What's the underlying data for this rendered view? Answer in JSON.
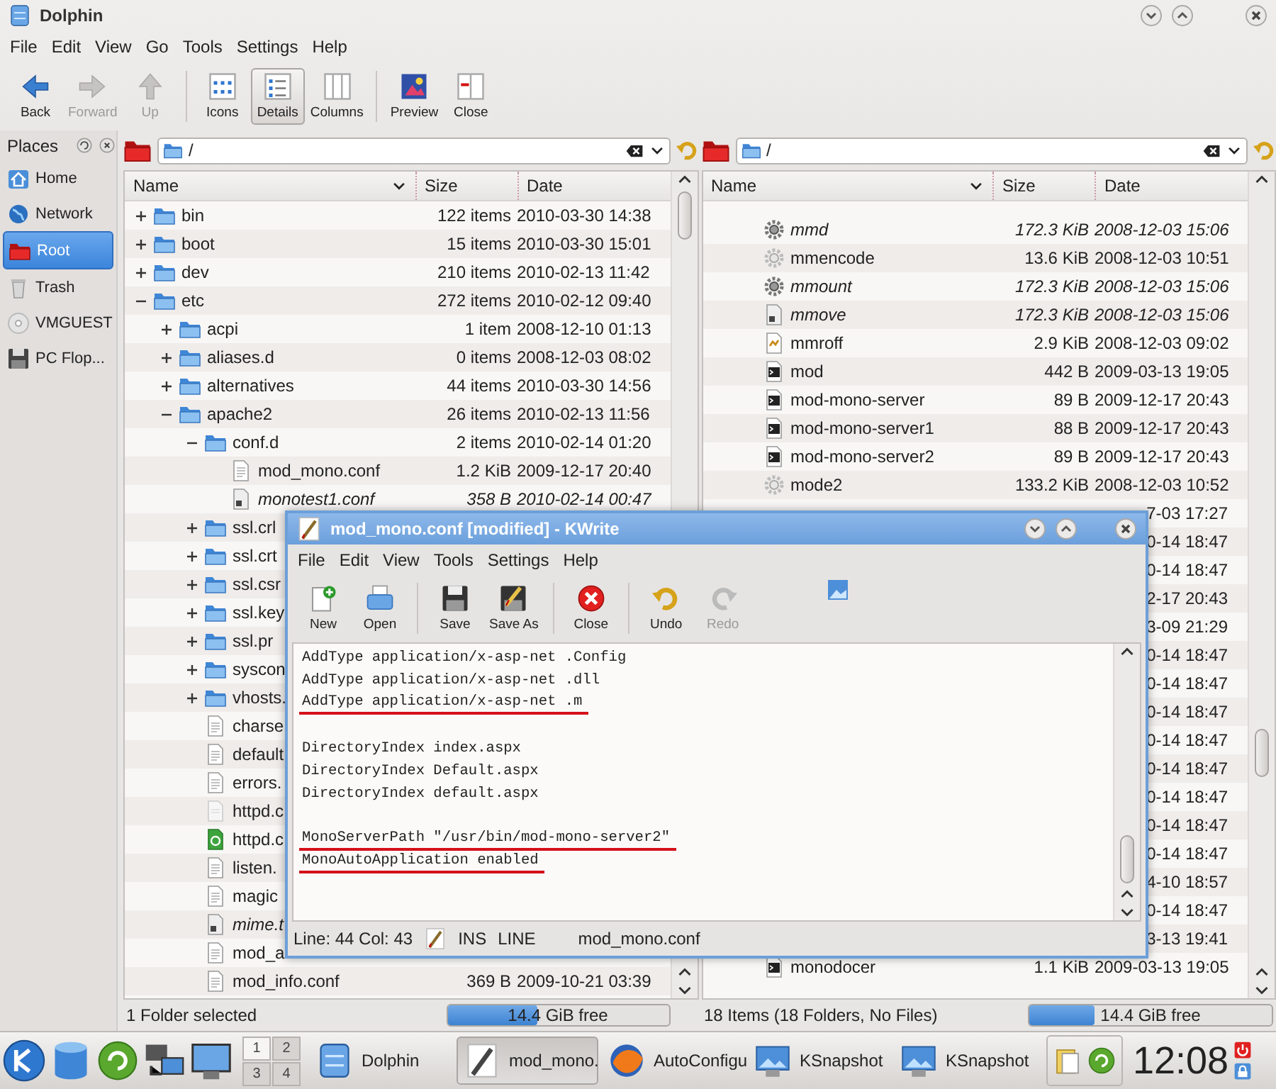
{
  "window": {
    "title": "Dolphin"
  },
  "menu": [
    "File",
    "Edit",
    "View",
    "Go",
    "Tools",
    "Settings",
    "Help"
  ],
  "nav": [
    {
      "label": "Back",
      "kind": "back",
      "disabled": false
    },
    {
      "label": "Forward",
      "kind": "forward",
      "disabled": true
    },
    {
      "label": "Up",
      "kind": "up",
      "disabled": true
    }
  ],
  "views": [
    {
      "label": "Icons",
      "kind": "icons",
      "selected": false
    },
    {
      "label": "Details",
      "kind": "details",
      "selected": true
    },
    {
      "label": "Columns",
      "kind": "columns",
      "selected": false
    }
  ],
  "actions": [
    {
      "label": "Preview",
      "kind": "preview"
    },
    {
      "label": "Close",
      "kind": "close"
    }
  ],
  "places": {
    "title": "Places",
    "items": [
      {
        "label": "Home",
        "kind": "home",
        "selected": false
      },
      {
        "label": "Network",
        "kind": "network",
        "selected": false
      },
      {
        "label": "Root",
        "kind": "root",
        "selected": true
      },
      {
        "label": "Trash",
        "kind": "trash",
        "selected": false
      },
      {
        "label": "VMGUEST",
        "kind": "disc",
        "selected": false
      },
      {
        "label": "PC Flop...",
        "kind": "floppy",
        "selected": false
      }
    ]
  },
  "panes": [
    {
      "kind": "tree",
      "location": "/",
      "columns": [
        "Name",
        "Size",
        "Date"
      ],
      "rows": [
        {
          "name": "bin",
          "size": "122 items",
          "date": "2010-03-30 14:38",
          "kind": "folder",
          "expanded": false
        },
        {
          "name": "boot",
          "size": "15 items",
          "date": "2010-03-30 15:01",
          "kind": "folder",
          "expanded": false
        },
        {
          "name": "dev",
          "size": "210 items",
          "date": "2010-02-13 11:42",
          "kind": "folder",
          "expanded": false
        },
        {
          "name": "etc",
          "size": "272 items",
          "date": "2010-02-12 09:40",
          "kind": "folder",
          "expanded": true,
          "children": [
            {
              "name": "acpi",
              "size": "1 item",
              "date": "2008-12-10 01:13",
              "kind": "folder",
              "expanded": false
            },
            {
              "name": "aliases.d",
              "size": "0 items",
              "date": "2008-12-03 08:02",
              "kind": "folder",
              "expanded": false
            },
            {
              "name": "alternatives",
              "size": "44 items",
              "date": "2010-03-30 14:56",
              "kind": "folder",
              "expanded": false
            },
            {
              "name": "apache2",
              "size": "26 items",
              "date": "2010-02-13 11:56",
              "kind": "folder",
              "expanded": true,
              "children": [
                {
                  "name": "conf.d",
                  "size": "2 items",
                  "date": "2010-02-14 01:20",
                  "kind": "folder",
                  "expanded": true,
                  "children": [
                    {
                      "name": "mod_mono.conf",
                      "size": "1.2 KiB",
                      "date": "2009-12-17 20:40",
                      "kind": "text"
                    },
                    {
                      "name": "monotest1.conf",
                      "size": "358 B",
                      "date": "2010-02-14 00:47",
                      "kind": "link"
                    }
                  ]
                },
                {
                  "name": "ssl.crl",
                  "kind": "folder",
                  "expanded": false
                },
                {
                  "name": "ssl.crt",
                  "kind": "folder",
                  "expanded": false
                },
                {
                  "name": "ssl.csr",
                  "kind": "folder",
                  "expanded": false
                },
                {
                  "name": "ssl.key",
                  "kind": "folder",
                  "expanded": false
                },
                {
                  "name": "ssl.pr",
                  "kind": "folder",
                  "expanded": false
                },
                {
                  "name": "syscon",
                  "kind": "folder",
                  "expanded": false
                },
                {
                  "name": "vhosts.",
                  "kind": "folder",
                  "expanded": false
                },
                {
                  "name": "charse",
                  "kind": "text"
                },
                {
                  "name": "default",
                  "kind": "text"
                },
                {
                  "name": "errors.",
                  "kind": "text"
                },
                {
                  "name": "httpd.c",
                  "kind": "html"
                },
                {
                  "name": "httpd.c",
                  "kind": "package"
                },
                {
                  "name": "listen.",
                  "kind": "text"
                },
                {
                  "name": "magic",
                  "kind": "text"
                },
                {
                  "name": "mime.t",
                  "kind": "link"
                },
                {
                  "name": "mod_a",
                  "kind": "text"
                },
                {
                  "name": "mod_info.conf",
                  "size": "369 B",
                  "date": "2009-10-21 03:39",
                  "kind": "text"
                }
              ]
            }
          ]
        }
      ],
      "status": "1 Folder selected",
      "free": {
        "label": "14.4 GiB free",
        "level": 0.41
      }
    },
    {
      "kind": "flat",
      "location": "/",
      "columns": [
        "Name",
        "Size",
        "Date"
      ],
      "rows": [
        {
          "name": "mmd",
          "size": "172.3 KiB",
          "date": "2008-12-03 15:06",
          "kind": "link-gear"
        },
        {
          "name": "mmencode",
          "size": "13.6 KiB",
          "date": "2008-12-03 10:51",
          "kind": "gear"
        },
        {
          "name": "mmount",
          "size": "172.3 KiB",
          "date": "2008-12-03 15:06",
          "kind": "link-gear"
        },
        {
          "name": "mmove",
          "size": "172.3 KiB",
          "date": "2008-12-03 15:06",
          "kind": "link"
        },
        {
          "name": "mmroff",
          "size": "2.9 KiB",
          "date": "2008-12-03 09:02",
          "kind": "script"
        },
        {
          "name": "mod",
          "size": "442 B",
          "date": "2009-03-13 19:05",
          "kind": "terminal"
        },
        {
          "name": "mod-mono-server",
          "size": "89 B",
          "date": "2009-12-17 20:43",
          "kind": "terminal"
        },
        {
          "name": "mod-mono-server1",
          "size": "88 B",
          "date": "2009-12-17 20:43",
          "kind": "terminal"
        },
        {
          "name": "mod-mono-server2",
          "size": "89 B",
          "date": "2009-12-17 20:43",
          "kind": "terminal"
        },
        {
          "name": "mode2",
          "size": "133.2 KiB",
          "date": "2008-12-03 10:52",
          "kind": "gear"
        },
        {
          "date": "7-03 17:27"
        },
        {
          "date": "0-14 18:47"
        },
        {
          "date": "0-14 18:47"
        },
        {
          "date": "2-17 20:43"
        },
        {
          "date": "3-09 21:29"
        },
        {
          "date": "0-14 18:47"
        },
        {
          "date": "0-14 18:47"
        },
        {
          "date": "0-14 18:47"
        },
        {
          "date": "0-14 18:47"
        },
        {
          "date": "0-14 18:47"
        },
        {
          "date": "0-14 18:47"
        },
        {
          "date": "0-14 18:47"
        },
        {
          "date": "0-14 18:47"
        },
        {
          "date": "4-10 18:57"
        },
        {
          "date": "0-14 18:47"
        },
        {
          "date": "3-13 19:41"
        },
        {
          "name": "monodocer",
          "size": "1.1 KiB",
          "date": "2009-03-13 19:05",
          "kind": "terminal"
        }
      ],
      "status": "18 Items (18 Folders, No Files)",
      "free": {
        "label": "14.4 GiB free",
        "level": 0.27
      }
    }
  ],
  "editor": {
    "title": "mod_mono.conf [modified] - KWrite",
    "menu": [
      "File",
      "Edit",
      "View",
      "Tools",
      "Settings",
      "Help"
    ],
    "toolbar": [
      {
        "label": "New",
        "kind": "new",
        "disabled": false
      },
      {
        "label": "Open",
        "kind": "open",
        "disabled": false
      },
      {
        "label": "Save",
        "kind": "save",
        "disabled": false
      },
      {
        "label": "Save As",
        "kind": "save-as",
        "disabled": false
      },
      {
        "label": "Close",
        "kind": "close",
        "disabled": false
      },
      {
        "label": "Undo",
        "kind": "undo",
        "disabled": false
      },
      {
        "label": "Redo",
        "kind": "redo",
        "disabled": true
      }
    ],
    "lines": [
      {
        "kind": "code",
        "text": "AddType application/x-asp-net .Config",
        "underlined": false
      },
      {
        "kind": "code",
        "text": "AddType application/x-asp-net .dll",
        "underlined": false
      },
      {
        "kind": "code",
        "text": "AddType application/x-asp-net .m",
        "underlined": true
      },
      {
        "kind": "blank"
      },
      {
        "kind": "code",
        "text": "DirectoryIndex index.aspx",
        "underlined": false
      },
      {
        "kind": "code",
        "text": "DirectoryIndex Default.aspx",
        "underlined": false
      },
      {
        "kind": "code",
        "text": "DirectoryIndex default.aspx",
        "underlined": false
      },
      {
        "kind": "blank"
      },
      {
        "kind": "code",
        "text": "MonoServerPath \"/usr/bin/mod-mono-server2\"",
        "underlined": true
      },
      {
        "kind": "code",
        "text": "MonoAutoApplication enabled",
        "underlined": true
      }
    ],
    "status": {
      "position": "Line: 44 Col: 43",
      "mode": "INS",
      "selection": "LINE",
      "file": "mod_mono.conf"
    }
  },
  "taskbar": {
    "pager": [
      {
        "label": "1",
        "selected": true
      },
      {
        "label": "2",
        "selected": false
      },
      {
        "label": "3",
        "selected": false
      },
      {
        "label": "4",
        "selected": false
      }
    ],
    "tasks": [
      {
        "label": "Dolphin",
        "kind": "files",
        "selected": false
      },
      {
        "label": "mod_mono.",
        "kind": "editor",
        "selected": true
      },
      {
        "label": "AutoConfigu",
        "kind": "browser",
        "selected": false
      },
      {
        "label": "KSnapshot",
        "kind": "snapshot",
        "selected": false
      },
      {
        "label": "KSnapshot",
        "kind": "snapshot",
        "selected": false
      }
    ],
    "clock": "12:08"
  }
}
